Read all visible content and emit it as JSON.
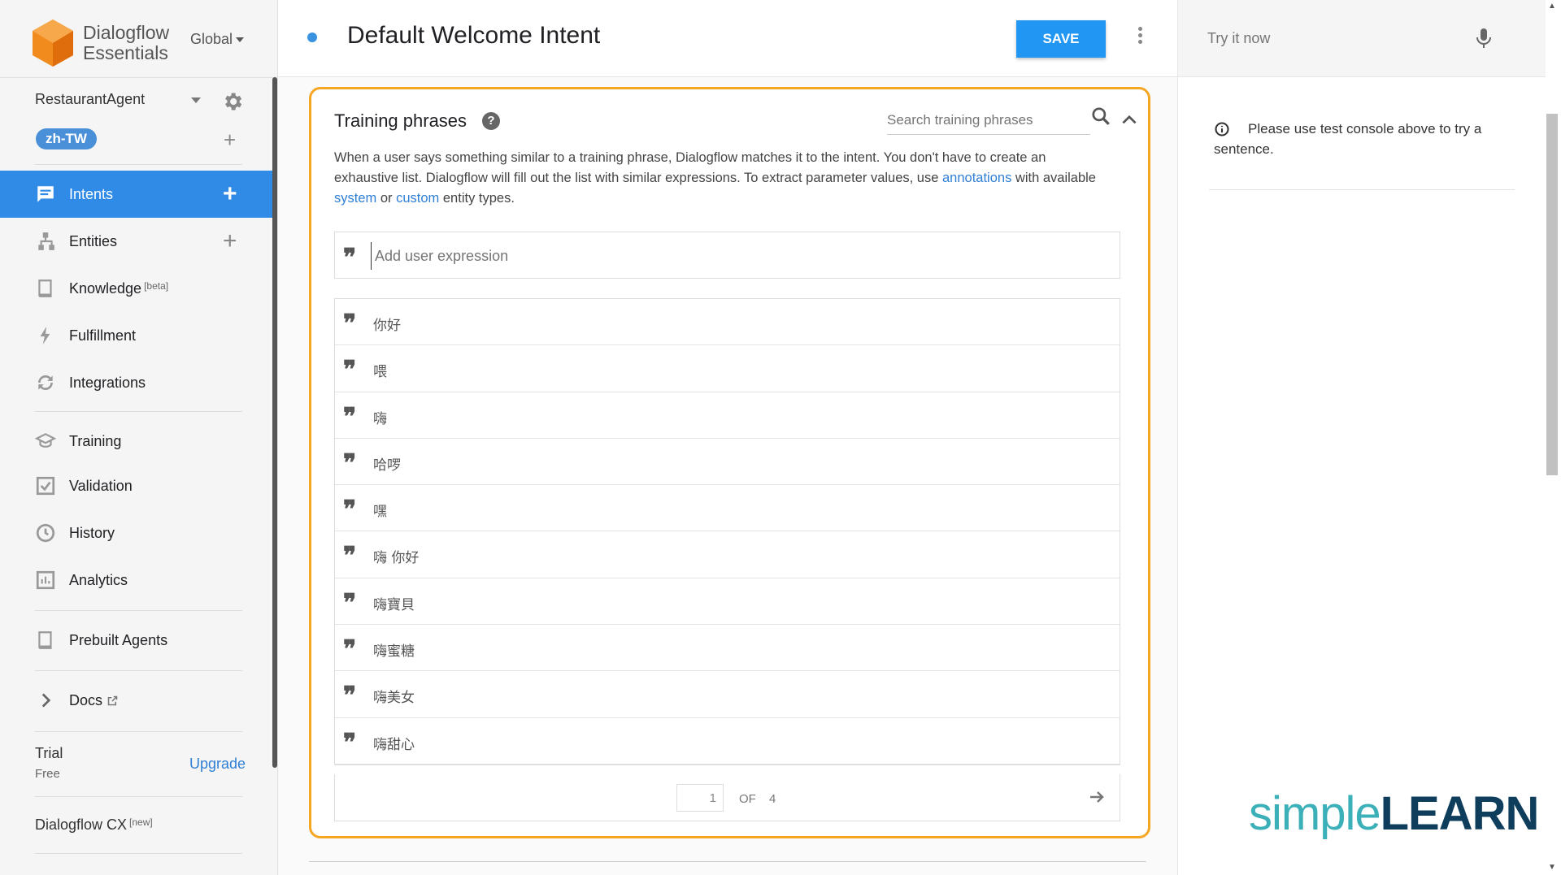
{
  "app": {
    "logo_line1": "Dialogflow",
    "logo_line2": "Essentials",
    "region": "Global",
    "agent": "RestaurantAgent",
    "language": "zh-TW"
  },
  "sidebar": {
    "items": [
      {
        "label": "Intents",
        "icon": "chat-icon"
      },
      {
        "label": "Entities",
        "icon": "hierarchy-icon"
      },
      {
        "label": "Knowledge",
        "tag": "[beta]",
        "icon": "book-icon"
      },
      {
        "label": "Fulfillment",
        "icon": "bolt-icon"
      },
      {
        "label": "Integrations",
        "icon": "sync-icon"
      },
      {
        "label": "Training",
        "icon": "graduation-cap-icon"
      },
      {
        "label": "Validation",
        "icon": "check-box-icon"
      },
      {
        "label": "History",
        "icon": "clock-icon"
      },
      {
        "label": "Analytics",
        "icon": "bar-chart-icon"
      },
      {
        "label": "Prebuilt Agents",
        "icon": "book-icon"
      },
      {
        "label": "Docs",
        "icon": "chevron-right-icon"
      }
    ],
    "trial_label": "Trial",
    "trial_sub": "Free",
    "upgrade_label": "Upgrade",
    "cx_label": "Dialogflow CX",
    "cx_tag": "[new]"
  },
  "header": {
    "intent_title": "Default Welcome Intent",
    "save_label": "SAVE"
  },
  "training": {
    "title": "Training phrases",
    "help_glyph": "?",
    "search_placeholder": "Search training phrases",
    "desc_part1": "When a user says something similar to a training phrase, Dialogflow matches it to the intent. You don't have to create an exhaustive list. Dialogflow will fill out the list with similar expressions. To extract parameter values, use ",
    "desc_link1": "annotations",
    "desc_part2": " with available ",
    "desc_link2": "system",
    "desc_part3": " or ",
    "desc_link3": "custom",
    "desc_part4": " entity types.",
    "add_placeholder": "Add user expression",
    "phrases": [
      "你好",
      "喂",
      "嗨",
      "哈啰",
      "嘿",
      "嗨 你好",
      "嗨寶貝",
      "嗨蜜糖",
      "嗨美女",
      "嗨甜心"
    ],
    "page_current": "1",
    "page_of": "OF",
    "page_total": "4"
  },
  "console": {
    "try_placeholder": "Try it now",
    "info_text": "Please use test console above to try a sentence."
  },
  "watermark": {
    "part1": "simple",
    "part2": "LEARN"
  },
  "colors": {
    "accent": "#2f8be6",
    "card_border": "#f5a623",
    "save": "#2196f3",
    "logo_orange": "#f28b1e"
  }
}
